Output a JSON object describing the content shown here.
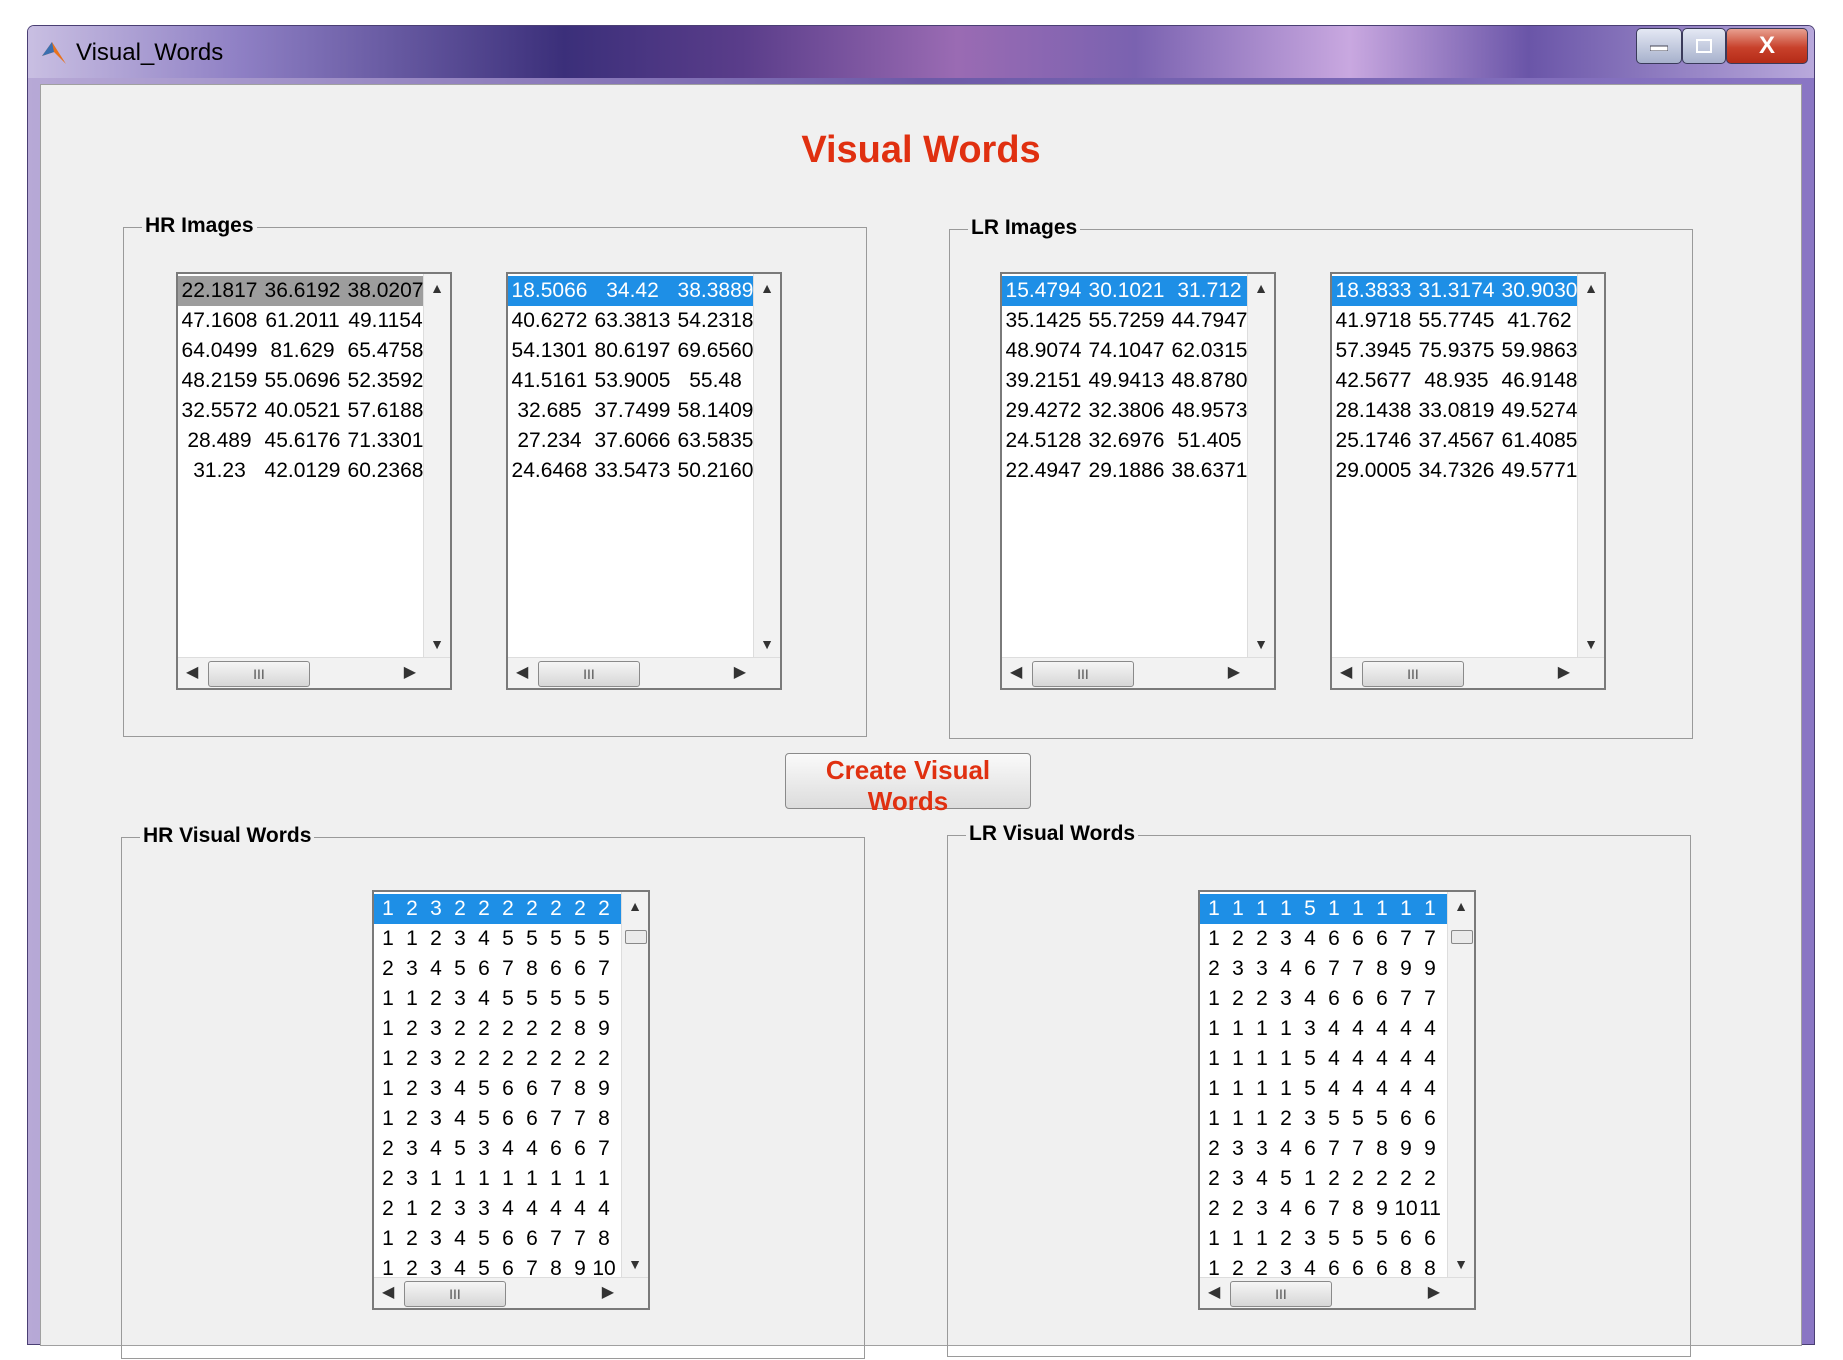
{
  "window": {
    "title": "Visual_Words",
    "close_label": "X"
  },
  "main_title": "Visual Words",
  "hr_images": {
    "label": "HR Images",
    "list1": [
      [
        "22.1817",
        "36.6192",
        "38.0207"
      ],
      [
        "47.1608",
        "61.2011",
        "49.1154"
      ],
      [
        "64.0499",
        "81.629",
        "65.4758"
      ],
      [
        "48.2159",
        "55.0696",
        "52.3592"
      ],
      [
        "32.5572",
        "40.0521",
        "57.6188"
      ],
      [
        "28.489",
        "45.6176",
        "71.3301"
      ],
      [
        "31.23",
        "42.0129",
        "60.2368"
      ]
    ],
    "list2": [
      [
        "18.5066",
        "34.42",
        "38.3889"
      ],
      [
        "40.6272",
        "63.3813",
        "54.2318"
      ],
      [
        "54.1301",
        "80.6197",
        "69.6560"
      ],
      [
        "41.5161",
        "53.9005",
        "55.48"
      ],
      [
        "32.685",
        "37.7499",
        "58.1409"
      ],
      [
        "27.234",
        "37.6066",
        "63.5835"
      ],
      [
        "24.6468",
        "33.5473",
        "50.2160"
      ]
    ]
  },
  "lr_images": {
    "label": "LR Images",
    "list1": [
      [
        "15.4794",
        "30.1021",
        "31.712"
      ],
      [
        "35.1425",
        "55.7259",
        "44.7947"
      ],
      [
        "48.9074",
        "74.1047",
        "62.0315"
      ],
      [
        "39.2151",
        "49.9413",
        "48.8780"
      ],
      [
        "29.4272",
        "32.3806",
        "48.9573"
      ],
      [
        "24.5128",
        "32.6976",
        "51.405"
      ],
      [
        "22.4947",
        "29.1886",
        "38.6371"
      ]
    ],
    "list2": [
      [
        "18.3833",
        "31.3174",
        "30.9030"
      ],
      [
        "41.9718",
        "55.7745",
        "41.762"
      ],
      [
        "57.3945",
        "75.9375",
        "59.9863"
      ],
      [
        "42.5677",
        "48.935",
        "46.9148"
      ],
      [
        "28.1438",
        "33.0819",
        "49.5274"
      ],
      [
        "25.1746",
        "37.4567",
        "61.4085"
      ],
      [
        "29.0005",
        "34.7326",
        "49.5771"
      ]
    ]
  },
  "create_button": "Create Visual Words",
  "hr_visual_words": {
    "label": "HR Visual Words",
    "rows": [
      [
        "1",
        "2",
        "3",
        "2",
        "2",
        "2",
        "2",
        "2",
        "2",
        "2"
      ],
      [
        "1",
        "1",
        "2",
        "3",
        "4",
        "5",
        "5",
        "5",
        "5",
        "5"
      ],
      [
        "2",
        "3",
        "4",
        "5",
        "6",
        "7",
        "8",
        "6",
        "6",
        "7"
      ],
      [
        "1",
        "1",
        "2",
        "3",
        "4",
        "5",
        "5",
        "5",
        "5",
        "5"
      ],
      [
        "1",
        "2",
        "3",
        "2",
        "2",
        "2",
        "2",
        "2",
        "8",
        "9"
      ],
      [
        "1",
        "2",
        "3",
        "2",
        "2",
        "2",
        "2",
        "2",
        "2",
        "2"
      ],
      [
        "1",
        "2",
        "3",
        "4",
        "5",
        "6",
        "6",
        "7",
        "8",
        "9"
      ],
      [
        "1",
        "2",
        "3",
        "4",
        "5",
        "6",
        "6",
        "7",
        "7",
        "8"
      ],
      [
        "2",
        "3",
        "4",
        "5",
        "3",
        "4",
        "4",
        "6",
        "6",
        "7"
      ],
      [
        "2",
        "3",
        "1",
        "1",
        "1",
        "1",
        "1",
        "1",
        "1",
        "1"
      ],
      [
        "2",
        "1",
        "2",
        "3",
        "3",
        "4",
        "4",
        "4",
        "4",
        "4"
      ],
      [
        "1",
        "2",
        "3",
        "4",
        "5",
        "6",
        "6",
        "7",
        "7",
        "8"
      ],
      [
        "1",
        "2",
        "3",
        "4",
        "5",
        "6",
        "7",
        "8",
        "9",
        "10"
      ]
    ]
  },
  "lr_visual_words": {
    "label": "LR Visual Words",
    "rows": [
      [
        "1",
        "1",
        "1",
        "1",
        "5",
        "1",
        "1",
        "1",
        "1",
        "1"
      ],
      [
        "1",
        "2",
        "2",
        "3",
        "4",
        "6",
        "6",
        "6",
        "7",
        "7"
      ],
      [
        "2",
        "3",
        "3",
        "4",
        "6",
        "7",
        "7",
        "8",
        "9",
        "9"
      ],
      [
        "1",
        "2",
        "2",
        "3",
        "4",
        "6",
        "6",
        "6",
        "7",
        "7"
      ],
      [
        "1",
        "1",
        "1",
        "1",
        "3",
        "4",
        "4",
        "4",
        "4",
        "4"
      ],
      [
        "1",
        "1",
        "1",
        "1",
        "5",
        "4",
        "4",
        "4",
        "4",
        "4"
      ],
      [
        "1",
        "1",
        "1",
        "1",
        "5",
        "4",
        "4",
        "4",
        "4",
        "4"
      ],
      [
        "1",
        "1",
        "1",
        "2",
        "3",
        "5",
        "5",
        "5",
        "6",
        "6"
      ],
      [
        "2",
        "3",
        "3",
        "4",
        "6",
        "7",
        "7",
        "8",
        "9",
        "9"
      ],
      [
        "2",
        "3",
        "4",
        "5",
        "1",
        "2",
        "2",
        "2",
        "2",
        "2"
      ],
      [
        "2",
        "2",
        "3",
        "4",
        "6",
        "7",
        "8",
        "9",
        "10",
        "11"
      ],
      [
        "1",
        "1",
        "1",
        "2",
        "3",
        "5",
        "5",
        "5",
        "6",
        "6"
      ],
      [
        "1",
        "2",
        "2",
        "3",
        "4",
        "6",
        "6",
        "6",
        "8",
        "8"
      ]
    ]
  }
}
